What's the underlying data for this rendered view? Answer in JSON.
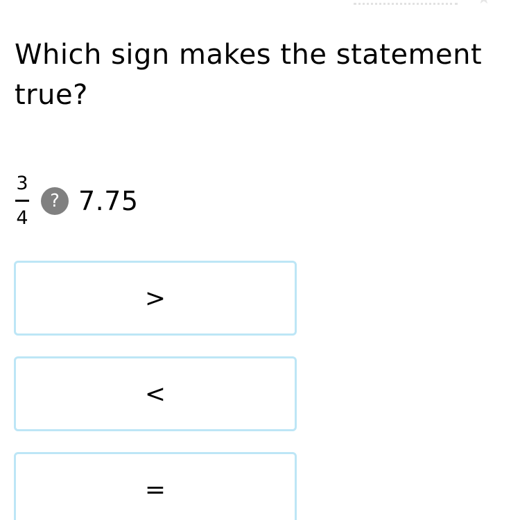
{
  "question": {
    "text": "Which sign makes the statement true?"
  },
  "expression": {
    "numerator": "3",
    "denominator": "4",
    "unknown_symbol": "?",
    "right_value": "7.75"
  },
  "choices": [
    {
      "label": ">"
    },
    {
      "label": "<"
    },
    {
      "label": "="
    }
  ],
  "colors": {
    "choice_border": "#bde6f6",
    "unknown_badge": "#808080",
    "text": "#000000"
  },
  "icons": {
    "top_right": "star-icon"
  }
}
